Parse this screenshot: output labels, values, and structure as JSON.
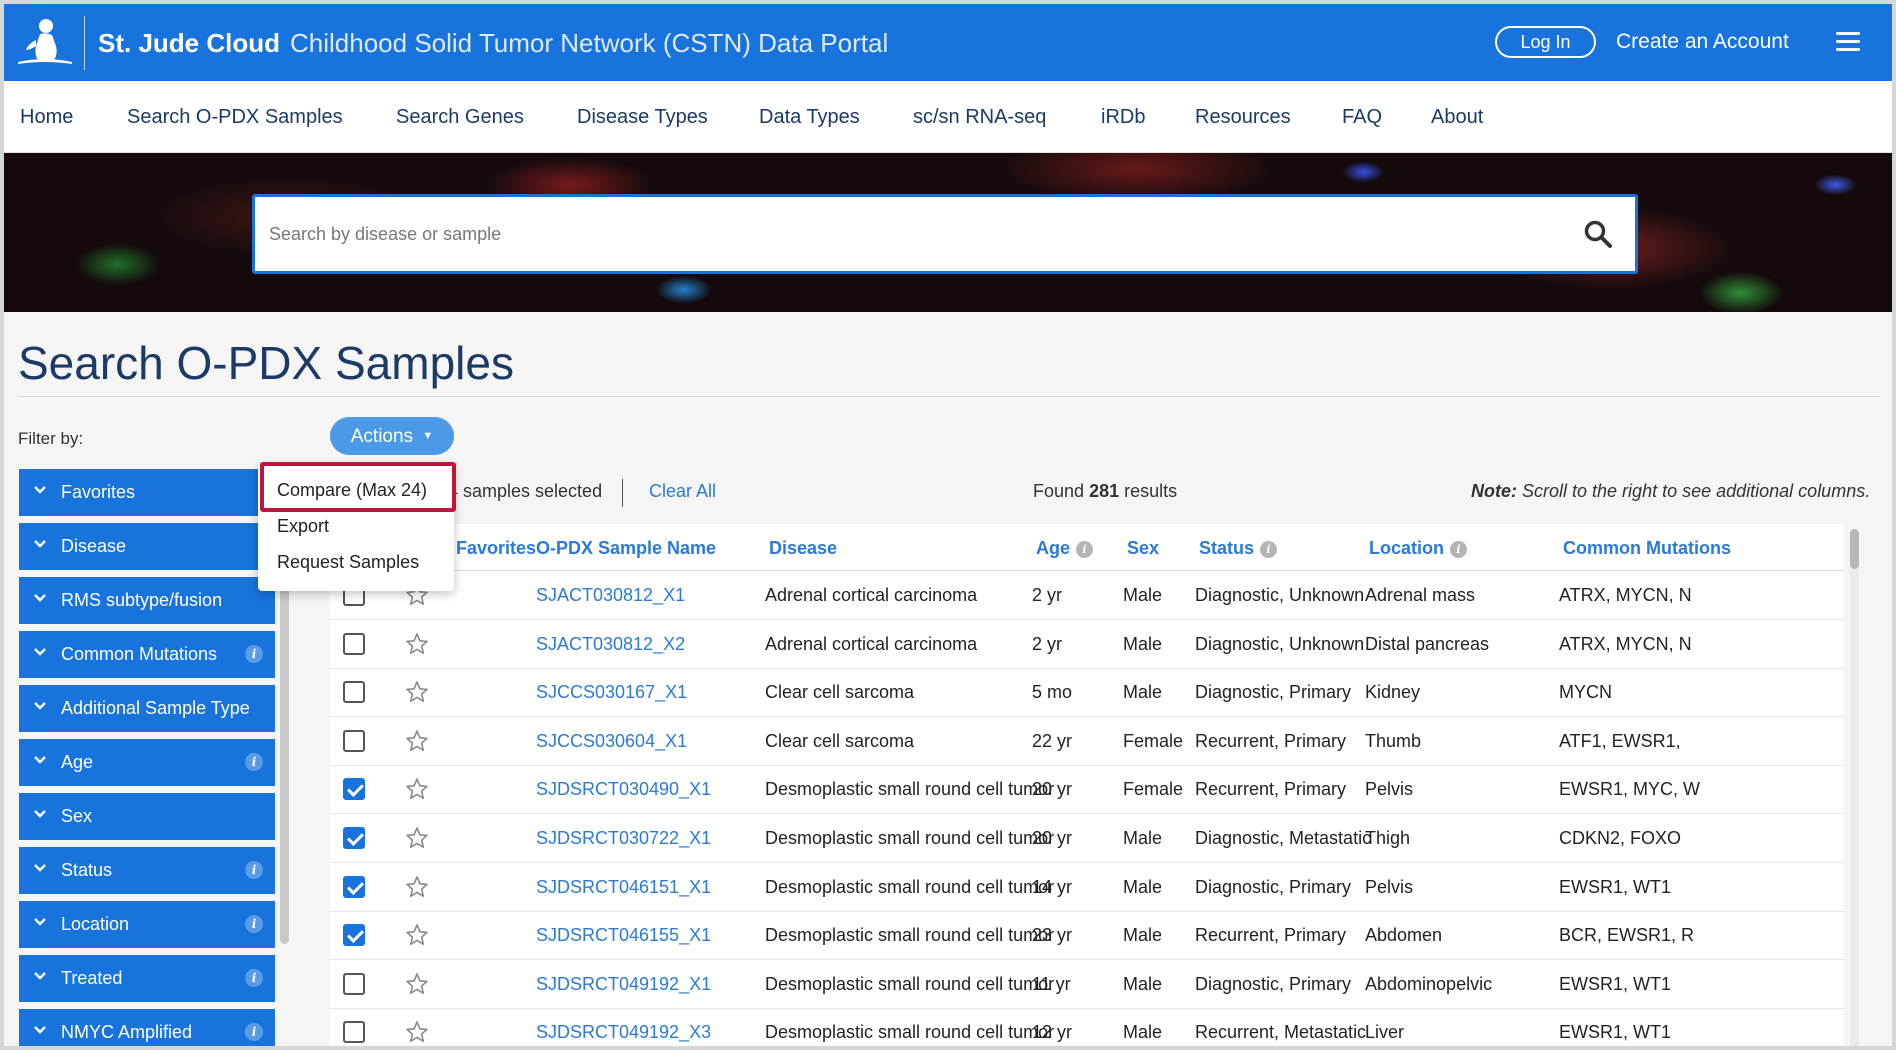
{
  "header": {
    "brand": "St. Jude Cloud",
    "subtitle": "Childhood Solid Tumor Network (CSTN) Data Portal",
    "login_label": "Log In",
    "create_account_label": "Create an Account",
    "brand_color": "#1874dc"
  },
  "nav": {
    "items": [
      "Home",
      "Search O-PDX Samples",
      "Search Genes",
      "Disease Types",
      "Data Types",
      "sc/sn RNA-seq",
      "iRDb",
      "Resources",
      "FAQ",
      "About"
    ]
  },
  "search": {
    "placeholder": "Search by disease or sample",
    "value": "",
    "icon": "search-icon"
  },
  "page": {
    "title": "Search O-PDX Samples",
    "filter_label": "Filter by:",
    "actions_label": "Actions"
  },
  "actions_menu": {
    "items": [
      "Compare (Max 24)",
      "Export",
      "Request Samples"
    ],
    "highlighted": "Compare (Max 24)"
  },
  "filters": [
    {
      "label": "Favorites",
      "info": false
    },
    {
      "label": "Disease",
      "info": false
    },
    {
      "label": "RMS subtype/fusion",
      "info": false
    },
    {
      "label": "Common Mutations",
      "info": true
    },
    {
      "label": "Additional Sample Type",
      "info": false
    },
    {
      "label": "Age",
      "info": true
    },
    {
      "label": "Sex",
      "info": false
    },
    {
      "label": "Status",
      "info": true
    },
    {
      "label": "Location",
      "info": true
    },
    {
      "label": "Treated",
      "info": true
    },
    {
      "label": "NMYC Amplified",
      "info": true
    }
  ],
  "results": {
    "selected_text": "4 samples selected",
    "clear_all": "Clear All",
    "found_prefix": "Found",
    "found_count": "281",
    "found_suffix": "results",
    "note_label": "Note:",
    "note_text": "Scroll to the right to see additional columns."
  },
  "table": {
    "columns": [
      "Favorites",
      "O-PDX Sample Name",
      "Disease",
      "Age",
      "Sex",
      "Status",
      "Location",
      "Common Mutations"
    ],
    "column_info": [
      false,
      false,
      false,
      true,
      false,
      true,
      true,
      false
    ],
    "rows": [
      {
        "checked": false,
        "name": "SJACT030812_X1",
        "disease": "Adrenal cortical carcinoma",
        "age": "2 yr",
        "sex": "Male",
        "status": "Diagnostic, Unknown",
        "location": "Adrenal mass",
        "mutations": "ATRX, MYCN, N"
      },
      {
        "checked": false,
        "name": "SJACT030812_X2",
        "disease": "Adrenal cortical carcinoma",
        "age": "2 yr",
        "sex": "Male",
        "status": "Diagnostic, Unknown",
        "location": "Distal pancreas",
        "mutations": "ATRX, MYCN, N"
      },
      {
        "checked": false,
        "name": "SJCCS030167_X1",
        "disease": "Clear cell sarcoma",
        "age": "5 mo",
        "sex": "Male",
        "status": "Diagnostic, Primary",
        "location": "Kidney",
        "mutations": "MYCN"
      },
      {
        "checked": false,
        "name": "SJCCS030604_X1",
        "disease": "Clear cell sarcoma",
        "age": "22 yr",
        "sex": "Female",
        "status": "Recurrent, Primary",
        "location": "Thumb",
        "mutations": "ATF1, EWSR1,"
      },
      {
        "checked": true,
        "name": "SJDSRCT030490_X1",
        "disease": "Desmoplastic small round cell tumor",
        "age": "20 yr",
        "sex": "Female",
        "status": "Recurrent, Primary",
        "location": "Pelvis",
        "mutations": "EWSR1, MYC, W"
      },
      {
        "checked": true,
        "name": "SJDSRCT030722_X1",
        "disease": "Desmoplastic small round cell tumor",
        "age": "20 yr",
        "sex": "Male",
        "status": "Diagnostic, Metastatic",
        "location": "Thigh",
        "mutations": "CDKN2, FOXO"
      },
      {
        "checked": true,
        "name": "SJDSRCT046151_X1",
        "disease": "Desmoplastic small round cell tumor",
        "age": "14 yr",
        "sex": "Male",
        "status": "Diagnostic, Primary",
        "location": "Pelvis",
        "mutations": "EWSR1, WT1"
      },
      {
        "checked": true,
        "name": "SJDSRCT046155_X1",
        "disease": "Desmoplastic small round cell tumor",
        "age": "23 yr",
        "sex": "Male",
        "status": "Recurrent, Primary",
        "location": "Abdomen",
        "mutations": "BCR, EWSR1, R"
      },
      {
        "checked": false,
        "name": "SJDSRCT049192_X1",
        "disease": "Desmoplastic small round cell tumor",
        "age": "11 yr",
        "sex": "Male",
        "status": "Diagnostic, Primary",
        "location": "Abdominopelvic",
        "mutations": "EWSR1, WT1"
      },
      {
        "checked": false,
        "name": "SJDSRCT049192_X3",
        "disease": "Desmoplastic small round cell tumor",
        "age": "12 yr",
        "sex": "Male",
        "status": "Recurrent, Metastatic",
        "location": "Liver",
        "mutations": "EWSR1, WT1"
      }
    ]
  }
}
